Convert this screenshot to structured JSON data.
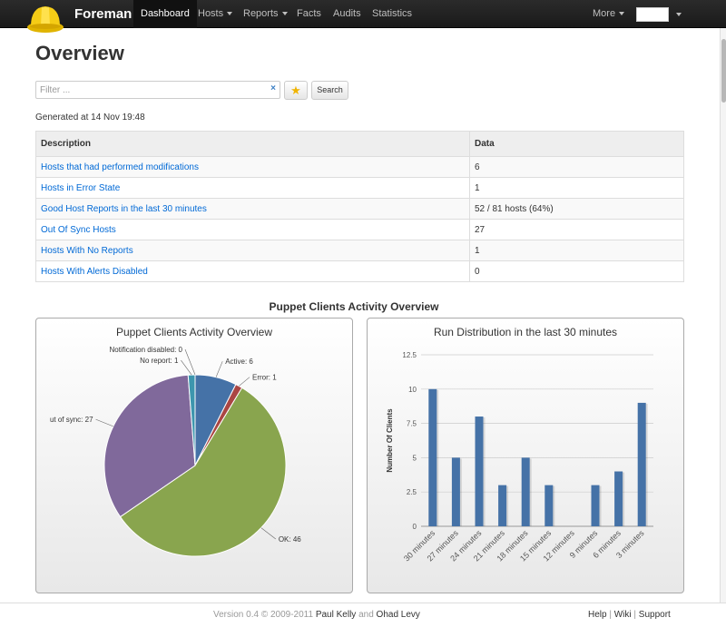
{
  "navbar": {
    "brand": "Foreman",
    "items": [
      {
        "label": "Dashboard",
        "active": true
      },
      {
        "label": "Hosts",
        "dropdown": true
      },
      {
        "label": "Reports",
        "dropdown": true
      },
      {
        "label": "Facts"
      },
      {
        "label": "Audits"
      },
      {
        "label": "Statistics"
      }
    ],
    "more": "More"
  },
  "page": {
    "title": "Overview",
    "filter_placeholder": "Filter ...",
    "clear_glyph": "×",
    "search_label": "Search",
    "generated": "Generated at 14 Nov 19:48"
  },
  "table": {
    "headers": [
      "Description",
      "Data"
    ],
    "rows": [
      {
        "description": "Hosts that had performed modifications",
        "data": "6"
      },
      {
        "description": "Hosts in Error State",
        "data": "1"
      },
      {
        "description": "Good Host Reports in the last 30 minutes",
        "data": "52 / 81 hosts (64%)"
      },
      {
        "description": "Out Of Sync Hosts",
        "data": "27"
      },
      {
        "description": "Hosts With No Reports",
        "data": "1"
      },
      {
        "description": "Hosts With Alerts Disabled",
        "data": "0"
      }
    ]
  },
  "charts_heading": "Puppet Clients Activity Overview",
  "chart_data": [
    {
      "type": "pie",
      "title": "Puppet Clients Activity Overview",
      "slices": [
        {
          "label": "Active",
          "value": 6,
          "color": "#4572a7"
        },
        {
          "label": "Error",
          "value": 1,
          "color": "#aa4643"
        },
        {
          "label": "OK",
          "value": 46,
          "color": "#89a54e"
        },
        {
          "label": "Out of sync",
          "value": 27,
          "color": "#80699b"
        },
        {
          "label": "No report",
          "value": 1,
          "color": "#3d96ae"
        },
        {
          "label": "Notification disabled",
          "value": 0,
          "color": "#db843d"
        }
      ],
      "visible_labels": [
        "Active: 6",
        "Error: 1",
        "OK: 46",
        "ut of sync: 27",
        "No report: 1",
        "Notification disabled: 0"
      ]
    },
    {
      "type": "bar",
      "title": "Run Distribution in the last 30 minutes",
      "ylabel": "Number Of Clients",
      "categories": [
        "30 minutes",
        "27 minutes",
        "24 minutes",
        "21 minutes",
        "18 minutes",
        "15 minutes",
        "12 minutes",
        "9 minutes",
        "6 minutes",
        "3 minutes"
      ],
      "values": [
        10,
        5,
        8,
        3,
        5,
        3,
        0,
        3,
        4,
        9
      ],
      "ylim": [
        0,
        12.5
      ],
      "yticks": [
        "0",
        "2.5",
        "5",
        "7.5",
        "10",
        "12.5"
      ],
      "color": "#4572a7"
    }
  ],
  "footer": {
    "version": "Version 0.4 © 2009-2011",
    "author1": "Paul Kelly",
    "and": "and",
    "author2": "Ohad Levy",
    "links": [
      "Help",
      "Wiki",
      "Support"
    ]
  }
}
